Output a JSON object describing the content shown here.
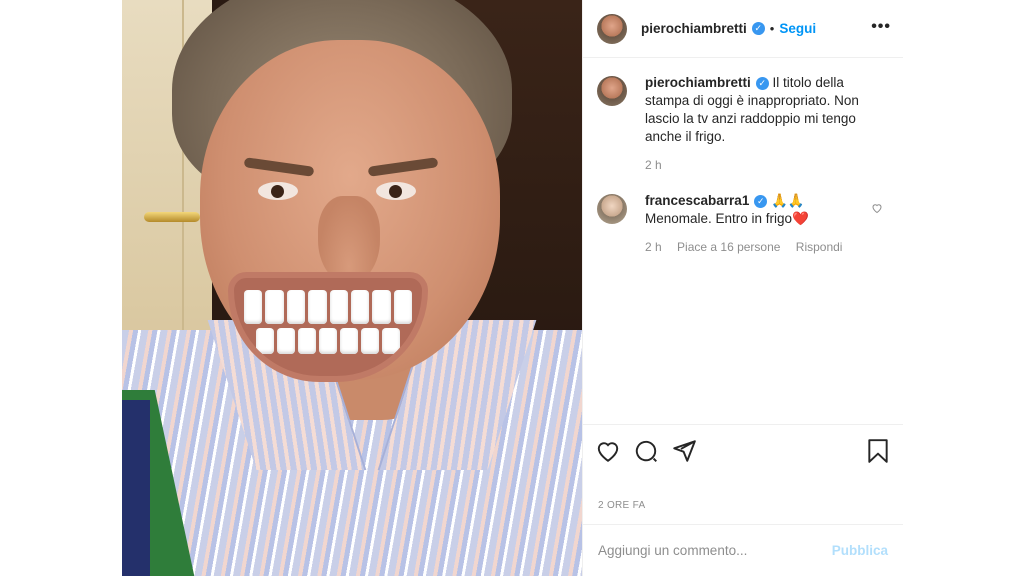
{
  "post": {
    "author": {
      "username": "pierochiambretti",
      "verified": true,
      "follow_label": "Segui",
      "separator": "•"
    },
    "more_icon": "more-dots-icon",
    "caption": {
      "username": "pierochiambretti",
      "text": "Il titolo della stampa di oggi è inappropriato. Non lascio la tv anzi raddoppio mi tengo anche il frigo.",
      "time": "2 h"
    },
    "comments": [
      {
        "username": "francescabarra1",
        "verified": true,
        "text": "Menomale. Entro in frigo❤️",
        "emoji_prefix": "🙏🙏",
        "time": "2 h",
        "likes": "Piace a 16 persone",
        "reply_label": "Rispondi"
      }
    ],
    "actions": {
      "like_icon": "heart-icon",
      "comment_icon": "comment-icon",
      "share_icon": "share-icon",
      "save_icon": "bookmark-icon"
    },
    "timestamp": "2 ORE FA",
    "add_comment": {
      "placeholder": "Aggiungi un commento...",
      "publish_label": "Pubblica"
    }
  },
  "colors": {
    "accent": "#0095f6",
    "verified": "#3897f0",
    "muted": "#8e8e8e",
    "publish_disabled": "#b2dffc"
  }
}
